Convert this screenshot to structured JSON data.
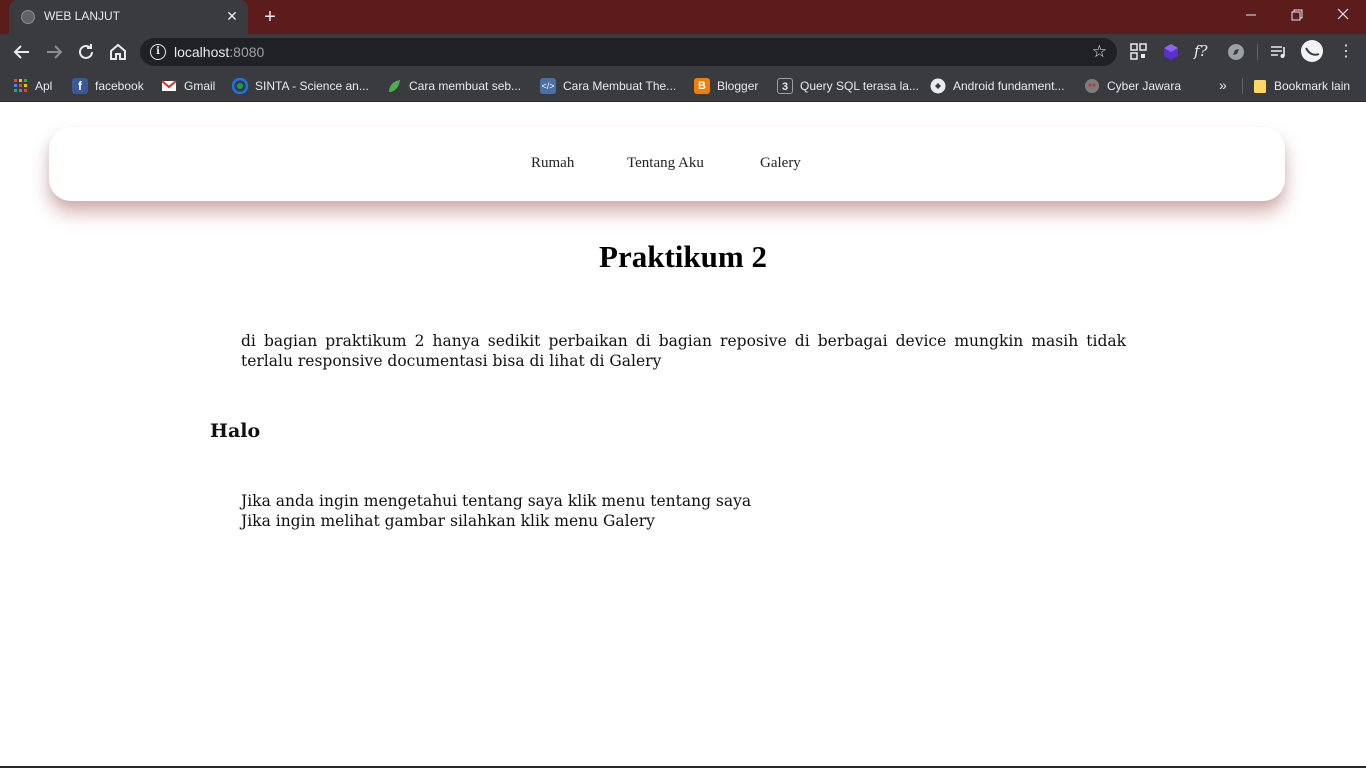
{
  "browser": {
    "tab": {
      "title": "WEB LANJUT",
      "favicon": "globe-icon"
    },
    "url": {
      "host": "localhost",
      "port": ":8080"
    },
    "bookmarks": [
      {
        "label": "Apl",
        "icon": "apps-grid-icon",
        "color": "#e94335"
      },
      {
        "label": "facebook",
        "icon": "facebook-icon",
        "color": "#3b5998"
      },
      {
        "label": "Gmail",
        "icon": "gmail-icon",
        "color": "#d93025"
      },
      {
        "label": "SINTA - Science an...",
        "icon": "sinta-icon",
        "color": "#1a73e8"
      },
      {
        "label": "Cara membuat seb...",
        "icon": "leaf-icon",
        "color": "#4caf50"
      },
      {
        "label": "Cara Membuat The...",
        "icon": "code-icon",
        "color": "#4a6fa5"
      },
      {
        "label": "Blogger",
        "icon": "blogger-icon",
        "color": "#f57d00"
      },
      {
        "label": "Query SQL terasa la...",
        "icon": "w3-icon",
        "color": "#5f6368"
      },
      {
        "label": "Android fundament...",
        "icon": "android-dev-icon",
        "color": "#e8eaed"
      },
      {
        "label": "Cyber Jawara",
        "icon": "cyber-jawara-icon",
        "color": "#c0392b"
      }
    ],
    "other_bookmarks": "Bookmark lain"
  },
  "page": {
    "nav": [
      "Rumah",
      "Tentang Aku",
      "Galery"
    ],
    "title": "Praktikum 2",
    "intro": "di bagian praktikum 2 hanya sedikit perbaikan di bagian reposive di berbagai device mungkin masih tidak terlalu responsive documentasi bisa di lihat di Galery",
    "heading": "Halo",
    "lines": [
      "Jika anda ingin mengetahui tentang saya klik menu tentang saya",
      "Jika ingin melihat gambar silahkan klik menu Galery"
    ]
  }
}
